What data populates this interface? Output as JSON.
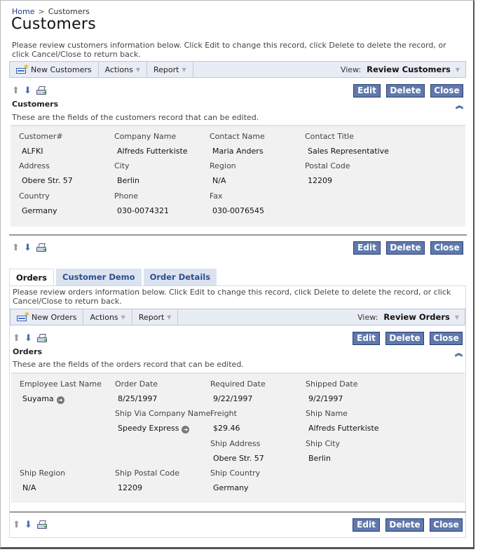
{
  "breadcrumb": {
    "home": "Home",
    "separator": ">",
    "current": "Customers"
  },
  "page": {
    "title": "Customers",
    "description": "Please review customers information below. Click Edit to change this record, click Delete to delete the record, or click Cancel/Close to return back."
  },
  "customers_toolbar": {
    "new_label": "New Customers",
    "actions_label": "Actions",
    "report_label": "Report",
    "view_label": "View:",
    "view_value": "Review Customers"
  },
  "buttons": {
    "edit": "Edit",
    "delete": "Delete",
    "close": "Close"
  },
  "customers_form": {
    "title": "Customers",
    "subtitle": "These are the fields of the customers record that can be edited.",
    "fields": [
      {
        "label": "Customer#",
        "value": "ALFKI"
      },
      {
        "label": "Company Name",
        "value": "Alfreds Futterkiste"
      },
      {
        "label": "Contact Name",
        "value": "Maria Anders"
      },
      {
        "label": "Contact Title",
        "value": "Sales Representative"
      },
      {
        "label": "Address",
        "value": "Obere Str. 57"
      },
      {
        "label": "City",
        "value": "Berlin"
      },
      {
        "label": "Region",
        "value": "N/A"
      },
      {
        "label": "Postal Code",
        "value": "12209"
      },
      {
        "label": "Country",
        "value": "Germany"
      },
      {
        "label": "Phone",
        "value": "030-0074321"
      },
      {
        "label": "Fax",
        "value": "030-0076545"
      }
    ]
  },
  "tabs": [
    {
      "label": "Orders",
      "active": true
    },
    {
      "label": "Customer Demo",
      "active": false
    },
    {
      "label": "Order Details",
      "active": false
    }
  ],
  "orders": {
    "description": "Please review orders information below. Click Edit to change this record, click Delete to delete the record, or click Cancel/Close to return back.",
    "toolbar": {
      "new_label": "New Orders",
      "actions_label": "Actions",
      "report_label": "Report",
      "view_label": "View:",
      "view_value": "Review Orders"
    },
    "form": {
      "title": "Orders",
      "subtitle": "These are the fields of the orders record that can be edited.",
      "fields": [
        {
          "label": "Employee Last Name",
          "value": "Suyama"
        },
        {
          "label": "Order Date",
          "value": "8/25/1997"
        },
        {
          "label": "Required Date",
          "value": "9/22/1997"
        },
        {
          "label": "Shipped Date",
          "value": "9/2/1997"
        },
        {
          "label": "Ship Via Company Name",
          "value": "Speedy Express"
        },
        {
          "label": "Freight",
          "value": "$29.46"
        },
        {
          "label": "Ship Name",
          "value": "Alfreds Futterkiste"
        },
        {
          "label": "Ship Address",
          "value": "Obere Str. 57"
        },
        {
          "label": "Ship City",
          "value": "Berlin"
        },
        {
          "label": "Ship Region",
          "value": "N/A"
        },
        {
          "label": "Ship Postal Code",
          "value": "12209"
        },
        {
          "label": "Ship Country",
          "value": "Germany"
        }
      ]
    }
  },
  "icons": {
    "goto": "➜",
    "chevron": "⌵",
    "collapse": "⌃⌃"
  }
}
